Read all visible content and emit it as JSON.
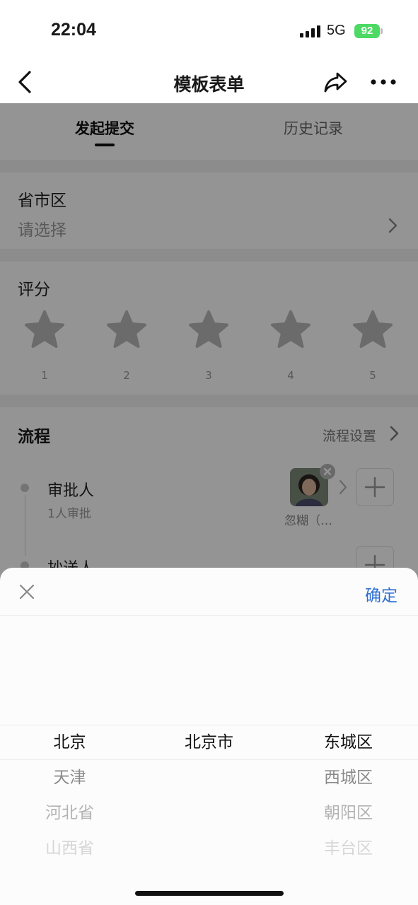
{
  "status_bar": {
    "time": "22:04",
    "network": "5G",
    "battery": "92"
  },
  "nav": {
    "title": "模板表单",
    "back_icon": "chevron-left-icon",
    "share_icon": "share-icon",
    "more_icon": "more-horizontal-icon"
  },
  "tabs": [
    {
      "label": "发起提交",
      "active": true
    },
    {
      "label": "历史记录",
      "active": false
    }
  ],
  "region_field": {
    "label": "省市区",
    "placeholder": "请选择"
  },
  "rating": {
    "label": "评分",
    "stars": [
      "1",
      "2",
      "3",
      "4",
      "5"
    ],
    "value": 0
  },
  "flow": {
    "title": "流程",
    "settings_label": "流程设置",
    "approver": {
      "role": "审批人",
      "sub": "1人审批",
      "name": "忽糊（…"
    },
    "cc": {
      "role": "抄送人"
    }
  },
  "picker": {
    "confirm_label": "确定",
    "provinces": [
      "北京",
      "天津",
      "河北省",
      "山西省"
    ],
    "cities": [
      "北京市"
    ],
    "districts": [
      "东城区",
      "西城区",
      "朝阳区",
      "丰台区"
    ]
  },
  "colors": {
    "accent": "#2e6fd1",
    "battery": "#4cd964",
    "overlay": "rgba(0,0,0,0.42)"
  }
}
